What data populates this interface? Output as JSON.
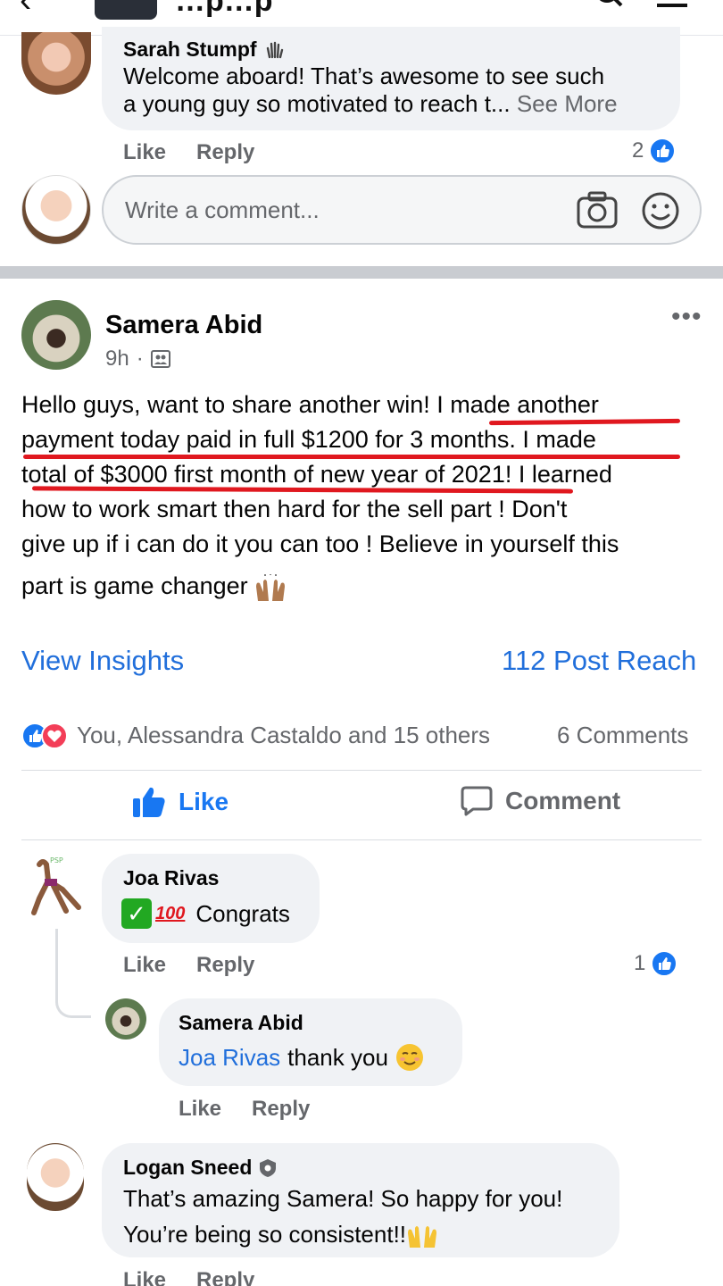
{
  "header": {
    "back_glyph": "‹",
    "group_title": "…p…p"
  },
  "comments_top": {
    "sarah": {
      "name": "Sarah Stumpf",
      "text_line1": "Welcome aboard! That’s awesome to see such",
      "text_line2": "a young guy so motivated to reach t...",
      "see_more": "See More",
      "like": "Like",
      "reply": "Reply",
      "reaction_count": "2"
    },
    "write_placeholder": "Write a comment..."
  },
  "post": {
    "author": "Samera Abid",
    "time": "9h",
    "separator": "·",
    "more": "•••",
    "lines": [
      "Hello guys, want to share another win! I made another",
      "payment today paid in full $1200 for 3 months.  I made",
      "total of $3000 first month of new year of 2021! I learned",
      "how to work smart then hard for the sell part !  Don't",
      "give up if i can do it you can too ! Believe in yourself this",
      "part is game changer"
    ],
    "view_insights": "View Insights",
    "post_reach": "112 Post Reach",
    "reactions_text": "You, Alessandra Castaldo and 15 others",
    "comments_count": "6 Comments",
    "like_button": "Like",
    "comment_button": "Comment"
  },
  "comments": [
    {
      "name": "Joa Rivas",
      "emoji_100": "100",
      "text": "Congrats",
      "like": "Like",
      "reply": "Reply",
      "reaction_count": "1"
    },
    {
      "name": "Samera Abid",
      "mention": "Joa Rivas",
      "text": "thank you",
      "like": "Like",
      "reply": "Reply"
    },
    {
      "name": "Logan Sneed",
      "text_line1": "That’s amazing Samera! So happy for you!",
      "text_line2": "You’re being so consistent!!",
      "like": "Like",
      "reply": "Reply"
    }
  ],
  "colors": {
    "facebook_blue": "#1877f2",
    "link_blue": "#216fdb",
    "underline_red": "#e0181f",
    "bubble_gray": "#f0f2f5",
    "muted_text": "#65676b"
  },
  "icons": [
    "back-icon",
    "search-icon",
    "menu-icon",
    "wave-icon",
    "like-reaction-icon",
    "camera-icon",
    "smiley-icon",
    "more-icon",
    "group-privacy-icon",
    "heart-reaction-icon",
    "thumbs-up-icon",
    "comment-icon",
    "check-emoji-icon",
    "hundred-emoji-icon",
    "blush-emoji-icon",
    "raised-hands-icon",
    "admin-badge-icon"
  ]
}
